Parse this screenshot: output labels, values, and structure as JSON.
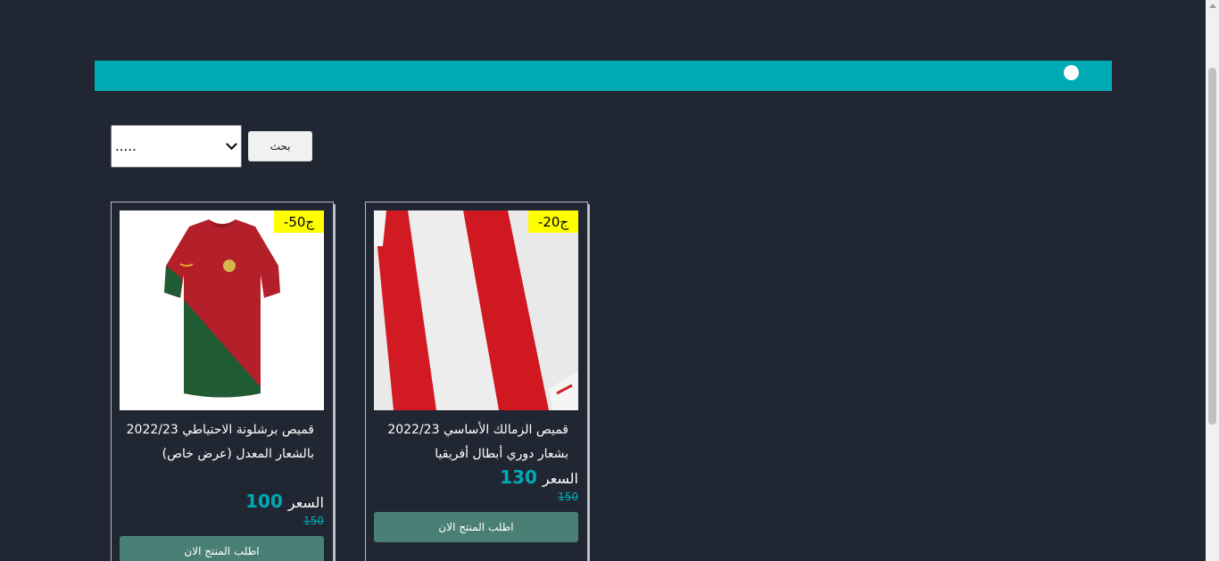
{
  "filter": {
    "selected": "....."
  },
  "search": {
    "label": "بحث"
  },
  "products": [
    {
      "badge": "-ج50",
      "title": "قميص برشلونة الاحتياطي 2022/23 بالشعار المعدل (عرض خاص)",
      "price_label": "السعر",
      "price": "100",
      "old_price": "150",
      "button": "اطلب المنتج الان"
    },
    {
      "badge": "-ج20",
      "title": "قميص الزمالك الأساسي 2022/23 بشعار دوري أبطال أفريقيا",
      "price_label": "السعر",
      "price": "130",
      "old_price": "150",
      "button": "اطلب المنتج الان"
    }
  ],
  "colors": {
    "background": "#202632",
    "accent": "#00aab3",
    "badge": "#ffff00",
    "button": "#4a7f76"
  }
}
